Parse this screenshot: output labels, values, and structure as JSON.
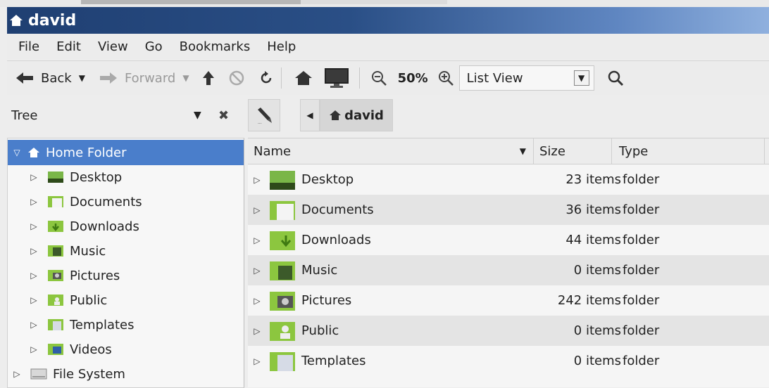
{
  "window": {
    "title": "david"
  },
  "menu": [
    "File",
    "Edit",
    "View",
    "Go",
    "Bookmarks",
    "Help"
  ],
  "toolbar": {
    "back": "Back",
    "forward": "Forward",
    "zoom": "50%",
    "view_mode": "List View"
  },
  "sidebar": {
    "title": "Tree",
    "items": [
      {
        "label": "Home Folder",
        "selected": true,
        "icon": "home-icon"
      },
      {
        "label": "Desktop",
        "icon": "desktop-folder-icon"
      },
      {
        "label": "Documents",
        "icon": "documents-folder-icon"
      },
      {
        "label": "Downloads",
        "icon": "downloads-folder-icon"
      },
      {
        "label": "Music",
        "icon": "music-folder-icon"
      },
      {
        "label": "Pictures",
        "icon": "pictures-folder-icon"
      },
      {
        "label": "Public",
        "icon": "public-folder-icon"
      },
      {
        "label": "Templates",
        "icon": "templates-folder-icon"
      },
      {
        "label": "Videos",
        "icon": "videos-folder-icon"
      },
      {
        "label": "File System",
        "icon": "drive-icon"
      }
    ]
  },
  "pathbar": {
    "current": "david"
  },
  "columns": {
    "name": "Name",
    "size": "Size",
    "type": "Type"
  },
  "files": [
    {
      "name": "Desktop",
      "size": "23 items",
      "type": "folder"
    },
    {
      "name": "Documents",
      "size": "36 items",
      "type": "folder"
    },
    {
      "name": "Downloads",
      "size": "44 items",
      "type": "folder"
    },
    {
      "name": "Music",
      "size": "0 items",
      "type": "folder"
    },
    {
      "name": "Pictures",
      "size": "242 items",
      "type": "folder"
    },
    {
      "name": "Public",
      "size": "0 items",
      "type": "folder"
    },
    {
      "name": "Templates",
      "size": "0 items",
      "type": "folder"
    }
  ],
  "colors": {
    "selection": "#4a7ecb",
    "title_bar": "#2a4f86",
    "folder": "#8cc63f"
  }
}
